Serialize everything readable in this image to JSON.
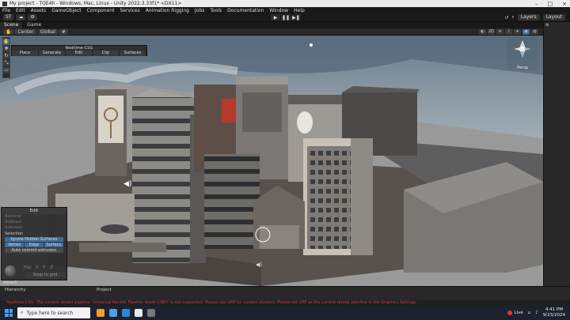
{
  "window": {
    "title": "My project - TOE4h - Windows, Mac, Linux - Unity 2022.3.33f1* <DX11>"
  },
  "menu": [
    "File",
    "Edit",
    "Assets",
    "GameObject",
    "Component",
    "Services",
    "Animation Rigging",
    "Jobs",
    "Tools",
    "Documentation",
    "Window",
    "Help"
  ],
  "toolbar": {
    "account": "ST",
    "layers": "Layers",
    "layout": "Layout"
  },
  "tabs": [
    "Scene",
    "Game"
  ],
  "scene_tools": {
    "pivot": "Center",
    "space": "Global",
    "zoom": "2D"
  },
  "realtime_csg": {
    "title": "Realtime-CSG",
    "modes": [
      "Place",
      "Generate",
      "Edit",
      "Clip",
      "Surfaces"
    ]
  },
  "gizmo": {
    "label": "Persp"
  },
  "edit_panel": {
    "title": "Edit",
    "greyed": [
      "Remove",
      "Subtract",
      "Intersect"
    ],
    "section": "Selection",
    "ignore_hidden": "Ignore Hidden Surfaces",
    "modes": [
      "Vertex",
      "Edge",
      "Surface"
    ],
    "auto_commit": "Auto commit extrusion",
    "flip_labels": [
      "Flip",
      "X",
      "Y",
      "Z"
    ],
    "snap": "Snap to grid"
  },
  "status_label": "stone3",
  "bottom_tabs": {
    "hierarchy": "Hierarchy",
    "project": "Project"
  },
  "error": "Realtime-CSG: The current render pipeline 'Universal Render Pipeline Asset (URP)' is not supported. Please use URP for custom shaders. Please set URP as the current render pipeline in the Graphics Settings.",
  "taskbar": {
    "search_placeholder": "Type here to search",
    "live": "Live",
    "time": "4:41 PM",
    "date": "9/23/2024"
  },
  "colors": {
    "accent": "#3d6c9c",
    "error": "#dd3333",
    "taskbar": "#1c2230"
  }
}
